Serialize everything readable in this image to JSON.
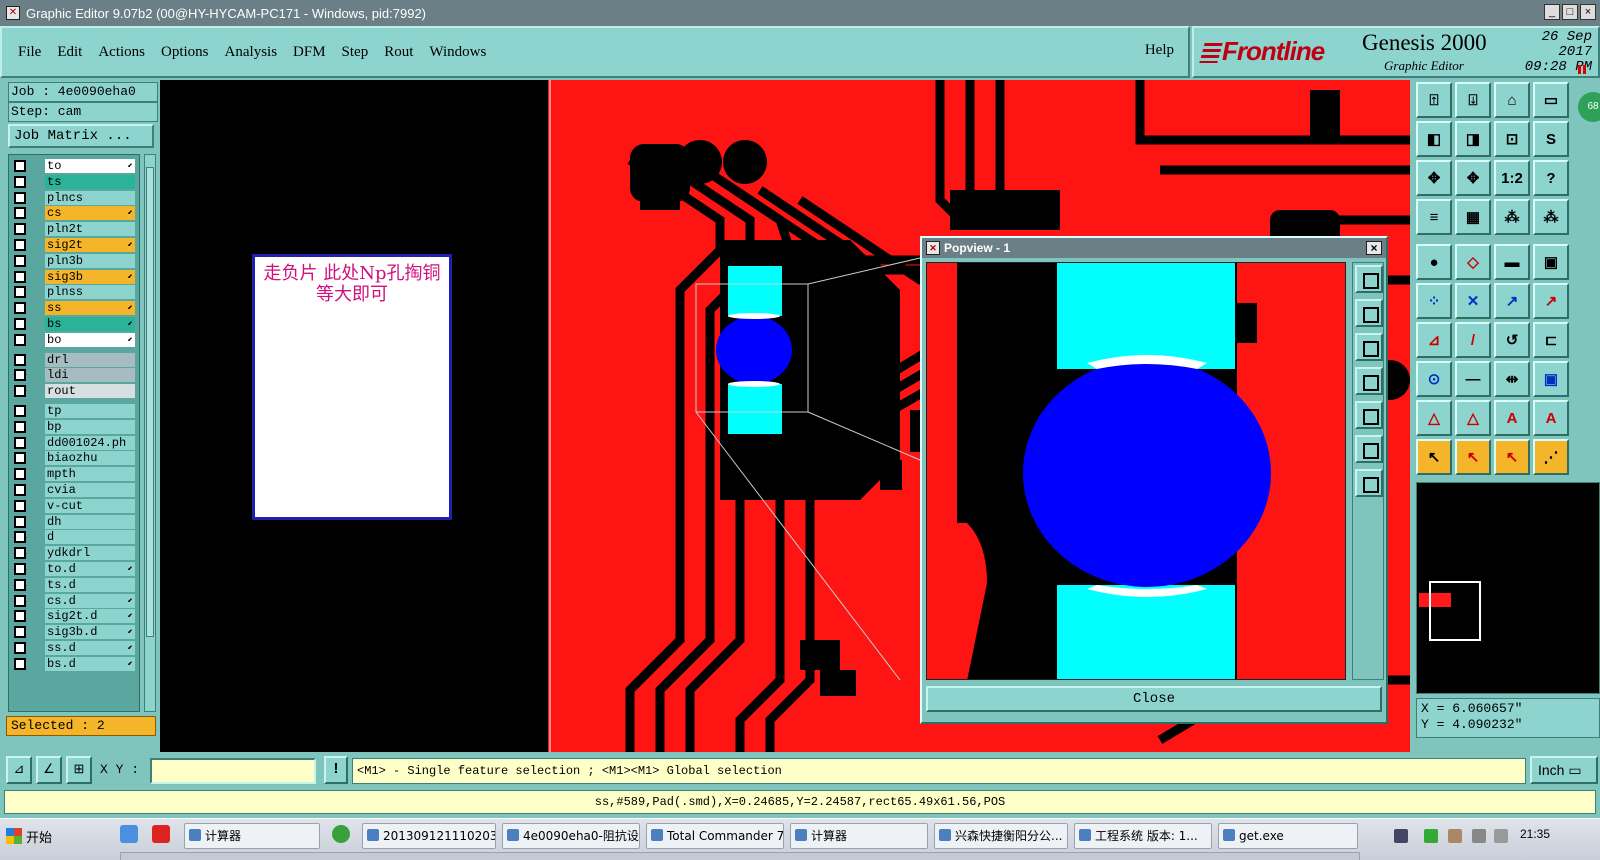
{
  "window": {
    "title": "Graphic Editor 9.07b2 (00@HY-HYCAM-PC171 - Windows, pid:7992)",
    "min": "_",
    "max": "□",
    "close": "×"
  },
  "menu": {
    "items": [
      "File",
      "Edit",
      "Actions",
      "Options",
      "Analysis",
      "DFM",
      "Step",
      "Rout",
      "Windows"
    ],
    "help": "Help"
  },
  "brand": {
    "logo": "Frontline",
    "product": "Genesis 2000",
    "subtitle": "Graphic Editor",
    "date": "26 Sep 2017",
    "time": "09:28 PM"
  },
  "job": {
    "job_line": "Job : 4e0090eha0",
    "step_line": "Step: cam",
    "matrix_button": "Job Matrix ..."
  },
  "layers": [
    {
      "name": "to",
      "color": "#ffffff",
      "arrow": true
    },
    {
      "name": "ts",
      "color": "#2bb39a",
      "arrow": false
    },
    {
      "name": "plncs",
      "color": "#8dd3ce",
      "arrow": false
    },
    {
      "name": "cs",
      "color": "#f5b52a",
      "arrow": true
    },
    {
      "name": "pln2t",
      "color": "#8dd3ce",
      "arrow": false
    },
    {
      "name": "sig2t",
      "color": "#f5b52a",
      "arrow": true
    },
    {
      "name": "pln3b",
      "color": "#8dd3ce",
      "arrow": false
    },
    {
      "name": "sig3b",
      "color": "#f5b52a",
      "arrow": true
    },
    {
      "name": "plnss",
      "color": "#8dd3ce",
      "arrow": false
    },
    {
      "name": "ss",
      "color": "#f5b52a",
      "arrow": true
    },
    {
      "name": "bs",
      "color": "#2bb39a",
      "arrow": true
    },
    {
      "name": "bo",
      "color": "#ffffff",
      "arrow": true
    },
    {
      "name": "drl",
      "color": "#a6bcc0",
      "arrow": false
    },
    {
      "name": "ldi",
      "color": "#a6bcc0",
      "arrow": false
    },
    {
      "name": "rout",
      "color": "#d8dfe0",
      "arrow": false
    },
    {
      "name": "tp",
      "color": "#8dd3ce",
      "arrow": false
    },
    {
      "name": "bp",
      "color": "#8dd3ce",
      "arrow": false
    },
    {
      "name": "dd001024.ph",
      "color": "#8dd3ce",
      "arrow": false
    },
    {
      "name": "biaozhu",
      "color": "#8dd3ce",
      "arrow": false
    },
    {
      "name": "mpth",
      "color": "#8dd3ce",
      "arrow": false
    },
    {
      "name": "cvia",
      "color": "#8dd3ce",
      "arrow": false
    },
    {
      "name": "v-cut",
      "color": "#8dd3ce",
      "arrow": false
    },
    {
      "name": "dh",
      "color": "#8dd3ce",
      "arrow": false
    },
    {
      "name": "d",
      "color": "#8dd3ce",
      "arrow": false
    },
    {
      "name": "ydkdrl",
      "color": "#8dd3ce",
      "arrow": false
    },
    {
      "name": "to.d",
      "color": "#8dd3ce",
      "arrow": true
    },
    {
      "name": "ts.d",
      "color": "#8dd3ce",
      "arrow": false
    },
    {
      "name": "cs.d",
      "color": "#8dd3ce",
      "arrow": true
    },
    {
      "name": "sig2t.d",
      "color": "#8dd3ce",
      "arrow": true
    },
    {
      "name": "sig3b.d",
      "color": "#8dd3ce",
      "arrow": true
    },
    {
      "name": "ss.d",
      "color": "#8dd3ce",
      "arrow": true
    },
    {
      "name": "bs.d",
      "color": "#8dd3ce",
      "arrow": true
    }
  ],
  "selected": "Selected : 2",
  "note": {
    "text": "走负片  此处Np孔掏铜等大即可"
  },
  "popview": {
    "title": "Popview - 1",
    "close_button": "Close"
  },
  "right_tools": {
    "rows": [
      [
        "⍐",
        "⍗",
        "⌂",
        "▭"
      ],
      [
        "◧",
        "◨",
        "⊡",
        "S"
      ],
      [
        "✥",
        "✥",
        "1:2",
        "?"
      ],
      [
        "≡",
        "▦",
        "⁂",
        "⁂"
      ],
      [
        "●",
        "◇",
        "▬",
        "▣"
      ],
      [
        "⁘",
        "✕",
        "↗",
        "↗"
      ],
      [
        "⊿",
        "/",
        "↺",
        "⊏"
      ],
      [
        "⊙",
        "—",
        "⇹",
        "▣"
      ],
      [
        "△",
        "△",
        "A",
        "A"
      ],
      [
        "↖",
        "↖",
        "↖",
        "⋰"
      ]
    ],
    "badge": "68"
  },
  "coords": {
    "x": "X = 6.060657\"",
    "y": "Y = 4.090232\""
  },
  "bottom": {
    "xy_label": "X Y :",
    "xy_value": "",
    "alert": "!",
    "message": "<M1> - Single feature selection ; <M1><M1> Global selection",
    "unit": "Inch ▭"
  },
  "status": "ss,#589,Pad(.smd),X=0.24685,Y=2.24587,rect65.49x61.56,POS",
  "taskbar": {
    "start": "开始",
    "tasks": [
      "计算器",
      "20130912111020367...",
      "4e0090eha0-阻抗设...",
      "Total Commander 7.0...",
      "计算器",
      "兴森快捷衡阳分公...",
      "工程系统  版本: 1...",
      "get.exe"
    ],
    "clock": "21:35"
  }
}
